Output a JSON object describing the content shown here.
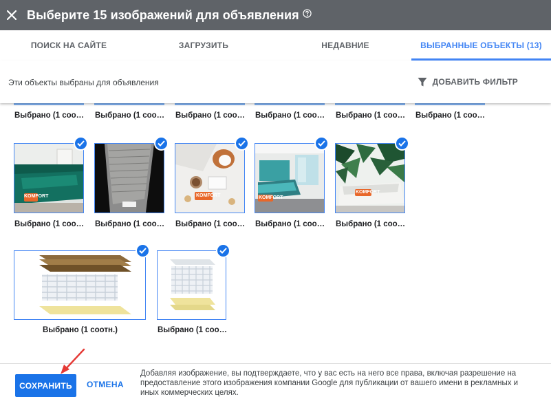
{
  "header": {
    "title": "Выберите 15 изображений для объявления",
    "close_icon": "close-icon",
    "help_icon": "help-circle-icon",
    "bg_color": "#5f6368"
  },
  "tabs": [
    {
      "label": "ПОИСК НА САЙТЕ",
      "active": false
    },
    {
      "label": "ЗАГРУЗИТЬ",
      "active": false
    },
    {
      "label": "НЕДАВНИЕ",
      "active": false
    },
    {
      "label": "ВЫБРАННЫЕ ОБЪЕКТЫ (13)",
      "active": true
    }
  ],
  "sub_bar": {
    "text": "Эти объекты выбраны для объявления",
    "filter_label": "ДОБАВИТЬ ФИЛЬТР",
    "filter_icon": "filter-funnel-icon"
  },
  "partial_row": {
    "labels": [
      "Выбрано (1 соо…",
      "Выбрано (1 соо…",
      "Выбрано (1 соо…",
      "Выбрано (1 соо…",
      "Выбрано (1 соо…",
      "Выбрано (1 соо…"
    ]
  },
  "row2": {
    "images": [
      {
        "label": "Выбрано (1 соо…",
        "icon": "green-bedding-image",
        "selected": true
      },
      {
        "label": "Выбрано (1 соо…",
        "icon": "mattress-fabric-closeup-image",
        "selected": true
      },
      {
        "label": "Выбрано (1 соо…",
        "icon": "bed-with-coffee-and-dog-image",
        "selected": true
      },
      {
        "label": "Выбрано (1 соо…",
        "icon": "bedroom-interior-image",
        "selected": true
      },
      {
        "label": "Выбрано (1 соо…",
        "icon": "tropical-leaves-bedroom-image",
        "selected": true
      }
    ]
  },
  "row3": {
    "images": [
      {
        "label": "Выбрано (1 соотн.)",
        "icon": "mattress-layers-wide-image",
        "selected": true
      },
      {
        "label": "Выбрано (1 соо…",
        "icon": "mattress-layers-square-image",
        "selected": true
      }
    ]
  },
  "watermark": "KOMFORT",
  "footer": {
    "save_label": "СОХРАНИТЬ",
    "cancel_label": "ОТМЕНА",
    "disclaimer": "Добавляя изображение, вы подтверждаете, что у вас есть на него все права, включая разрешение на предоставление этого изображения компании Google для публикации от вашего имени в рекламных и иных коммерческих целях.",
    "arrow_icon": "red-arrow-annotation-icon"
  },
  "colors": {
    "accent": "#1a73e8",
    "tab_active": "#4285f4",
    "annotation": "#e53935"
  }
}
